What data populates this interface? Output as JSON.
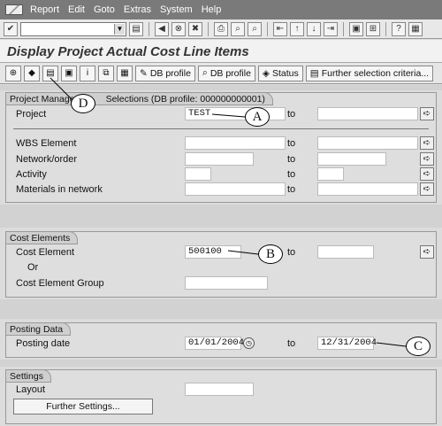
{
  "menubar": {
    "items": [
      {
        "label": "Report",
        "ul": "R",
        "rest": "eport"
      },
      {
        "label": "Edit",
        "ul": "E",
        "rest": "dit"
      },
      {
        "label": "Goto",
        "ul": "G",
        "rest": "oto"
      },
      {
        "label": "Extras",
        "ul": "x",
        "pre": "E",
        "rest": "tras"
      },
      {
        "label": "System",
        "ul": "S",
        "rest": "ystem"
      },
      {
        "label": "Help",
        "ul": "H",
        "rest": "elp"
      }
    ]
  },
  "toolbar": {
    "icons": [
      "check-icon",
      "back-icon",
      "exit-icon",
      "cancel-icon",
      "print-icon",
      "find-icon",
      "find-next-icon",
      "first-page-icon",
      "prev-page-icon",
      "next-page-icon",
      "last-page-icon",
      "new-session-icon",
      "shortcut-icon",
      "help-icon",
      "layout-icon"
    ]
  },
  "title": "Display Project Actual Cost Line Items",
  "appbar": {
    "db_profile_1": "DB profile",
    "db_profile_2": "DB profile",
    "status": "Status",
    "further_selection": "Further selection criteria..."
  },
  "project_group": {
    "title_left": "Project Managem",
    "title_right": "Selections (DB profile: 000000000001)",
    "project_label": "Project",
    "project_from": "TEST",
    "to": "to",
    "wbs_label": "WBS Element",
    "network_label": "Network/order",
    "activity_label": "Activity",
    "materials_label": "Materials in network"
  },
  "cost_group": {
    "title": "Cost Elements",
    "cost_element_label": "Cost Element",
    "cost_element_from": "500100",
    "to": "to",
    "or_label": "Or",
    "group_label": "Cost Element Group"
  },
  "posting_group": {
    "title": "Posting Data",
    "posting_date_label": "Posting date",
    "from": "01/01/2004",
    "to_label": "to",
    "to_value": "12/31/2004"
  },
  "settings_group": {
    "title": "Settings",
    "layout_label": "Layout",
    "further_settings": "Further Settings..."
  },
  "callouts": {
    "a": "A",
    "b": "B",
    "c": "C",
    "d": "D"
  }
}
